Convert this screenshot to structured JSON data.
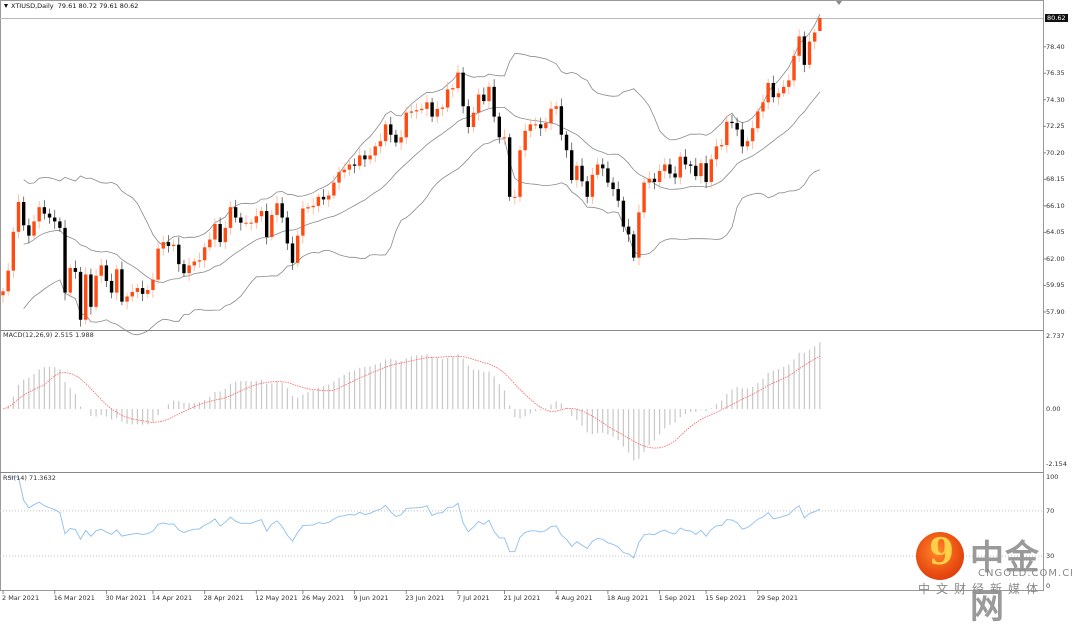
{
  "header": {
    "symbol_label": "XTIUSD,Daily",
    "ohlc_label": "79.61 80.72 79.61 80.62"
  },
  "current_price_label": "80.62",
  "indicators": {
    "macd_label": "MACD(12,26,9) 2.515 1.988",
    "rsi_label": "RSI(14) 71.3632"
  },
  "logo": {
    "name": "中金网",
    "domain": "CNGOLD.COM.CN",
    "tagline": "中文财经新媒体"
  },
  "colors": {
    "bull": "#ff4a12",
    "bear": "#000000",
    "bands": "#8a8a8a",
    "macd_hist": "#c8c8c8",
    "macd_signal": "#ff6060",
    "rsi_line": "#8cbef0",
    "grid_level": "#c0c0c0"
  },
  "chart_data": [
    {
      "type": "candlestick",
      "title": "XTIUSD,Daily",
      "last_bar": {
        "open": 79.61,
        "high": 80.72,
        "low": 79.61,
        "close": 80.62
      },
      "overlay": "Bollinger Bands",
      "y_ticks": [
        "80.62",
        "78.40",
        "76.35",
        "74.30",
        "72.25",
        "70.20",
        "68.15",
        "66.10",
        "64.05",
        "62.00",
        "59.95",
        "57.90"
      ],
      "ylim": [
        57.9,
        80.62
      ],
      "x_ticks": [
        {
          "label": "2 Mar 2021",
          "bar": 0
        },
        {
          "label": "16 Mar 2021",
          "bar": 10
        },
        {
          "label": "30 Mar 2021",
          "bar": 20
        },
        {
          "label": "14 Apr 2021",
          "bar": 29
        },
        {
          "label": "28 Apr 2021",
          "bar": 39
        },
        {
          "label": "12 May 2021",
          "bar": 49
        },
        {
          "label": "26 May 2021",
          "bar": 58
        },
        {
          "label": "9 Jun 2021",
          "bar": 68
        },
        {
          "label": "23 Jun 2021",
          "bar": 78
        },
        {
          "label": "7 Jul 2021",
          "bar": 88
        },
        {
          "label": "21 Jul 2021",
          "bar": 97
        },
        {
          "label": "4 Aug 2021",
          "bar": 107
        },
        {
          "label": "18 Aug 2021",
          "bar": 117
        },
        {
          "label": "1 Sep 2021",
          "bar": 127
        },
        {
          "label": "15 Sep 2021",
          "bar": 136
        },
        {
          "label": "29 Sep 2021",
          "bar": 146
        }
      ],
      "closes": [
        59.5,
        61.1,
        64.1,
        66.4,
        64.6,
        63.8,
        64.9,
        66.0,
        65.5,
        65.2,
        64.9,
        64.4,
        59.4,
        61.3,
        61.0,
        57.3,
        60.8,
        58.3,
        60.7,
        61.5,
        60.3,
        59.4,
        61.2,
        58.7,
        59.1,
        59.45,
        59.75,
        59.3,
        59.6,
        60.4,
        62.8,
        63.3,
        63.0,
        63.1,
        61.6,
        60.9,
        61.5,
        61.8,
        61.9,
        62.9,
        63.5,
        64.7,
        63.3,
        64.4,
        66.0,
        65.2,
        64.8,
        64.8,
        64.8,
        65.3,
        65.7,
        63.7,
        65.4,
        66.3,
        65.2,
        63.2,
        61.7,
        63.8,
        65.9,
        66.0,
        66.1,
        66.8,
        66.6,
        66.9,
        67.9,
        68.7,
        68.9,
        69.3,
        69.2,
        70.0,
        69.7,
        70.0,
        70.7,
        71.1,
        72.4,
        71.6,
        71.0,
        71.4,
        73.3,
        73.4,
        73.5,
        73.6,
        74.1,
        73.0,
        73.6,
        73.7,
        75.1,
        75.2,
        76.4,
        73.8,
        72.2,
        73.3,
        74.7,
        74.2,
        75.3,
        73.0,
        71.4,
        71.4,
        66.8,
        66.8,
        70.4,
        71.9,
        72.4,
        72.4,
        72.1,
        72.5,
        73.6,
        73.8,
        71.6,
        70.4,
        68.1,
        69.2,
        68.0,
        66.8,
        68.5,
        69.3,
        69.0,
        67.9,
        67.4,
        66.5,
        64.5,
        63.9,
        62.1,
        65.6,
        67.9,
        68.2,
        67.95,
        68.8,
        69.3,
        68.6,
        68.3,
        69.9,
        69.3,
        69.2,
        68.4,
        69.4,
        67.95,
        69.7,
        70.7,
        70.8,
        72.6,
        72.5,
        72.0,
        70.7,
        71.1,
        72.1,
        73.4,
        74.1,
        75.6,
        74.5,
        74.8,
        75.3,
        75.8,
        77.7,
        79.2,
        77.0,
        78.8,
        79.5,
        80.62
      ]
    },
    {
      "type": "bar",
      "title": "MACD(12,26,9)",
      "values_shown": {
        "macd": 2.515,
        "signal": 1.988
      },
      "y_ticks": [
        "2.737",
        "0.00",
        "-2.154"
      ],
      "ylim": [
        -2.154,
        2.737
      ]
    },
    {
      "type": "line",
      "title": "RSI(14)",
      "values_shown": {
        "rsi": 71.3632
      },
      "y_ticks": [
        "100",
        "70",
        "30",
        "0"
      ],
      "ylim": [
        0,
        100
      ],
      "levels": [
        70,
        30
      ]
    }
  ]
}
